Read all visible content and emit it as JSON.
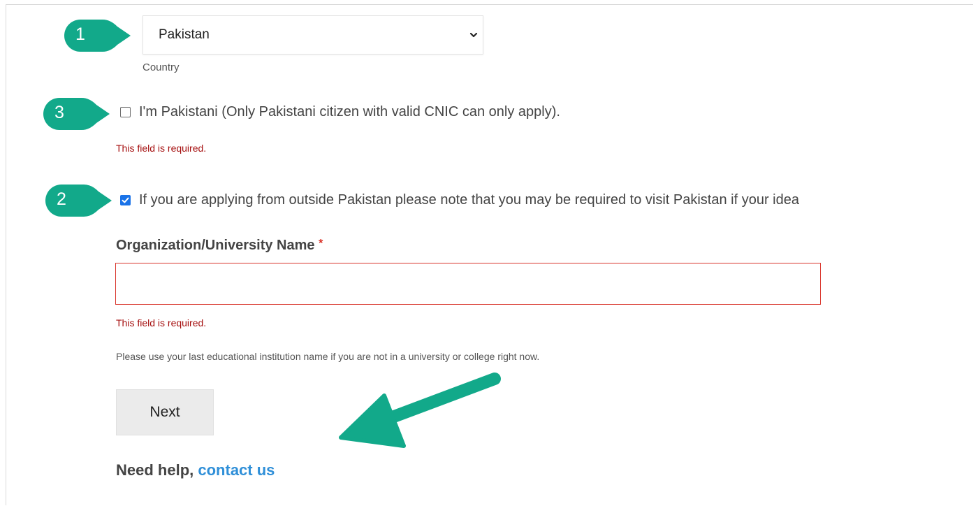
{
  "colors": {
    "badge": "#12a98a",
    "error": "#a50e0e",
    "link": "#2f8fd8",
    "checkbox": "#1a73e8"
  },
  "badges": {
    "b1": "1",
    "b3": "3",
    "b2": "2"
  },
  "country": {
    "selected": "Pakistan",
    "label": "Country",
    "icon": "chevron-down-icon"
  },
  "pakistani_checkbox": {
    "checked": false,
    "label": "I'm Pakistani (Only Pakistani citizen with valid CNIC can only apply).",
    "error": "This field is required."
  },
  "outside_checkbox": {
    "checked": true,
    "label": "If you are applying from outside Pakistan please note that you may be required to visit Pakistan if your idea"
  },
  "organization": {
    "label": "Organization/University Name",
    "required_mark": "*",
    "value": "",
    "error": "This field is required.",
    "hint": "Please use your last educational institution name if you are not in a university or college right now."
  },
  "next_button": {
    "label": "Next"
  },
  "help": {
    "text": "Need help,",
    "link": "contact us"
  },
  "annotation": {
    "icon": "arrow-icon"
  }
}
